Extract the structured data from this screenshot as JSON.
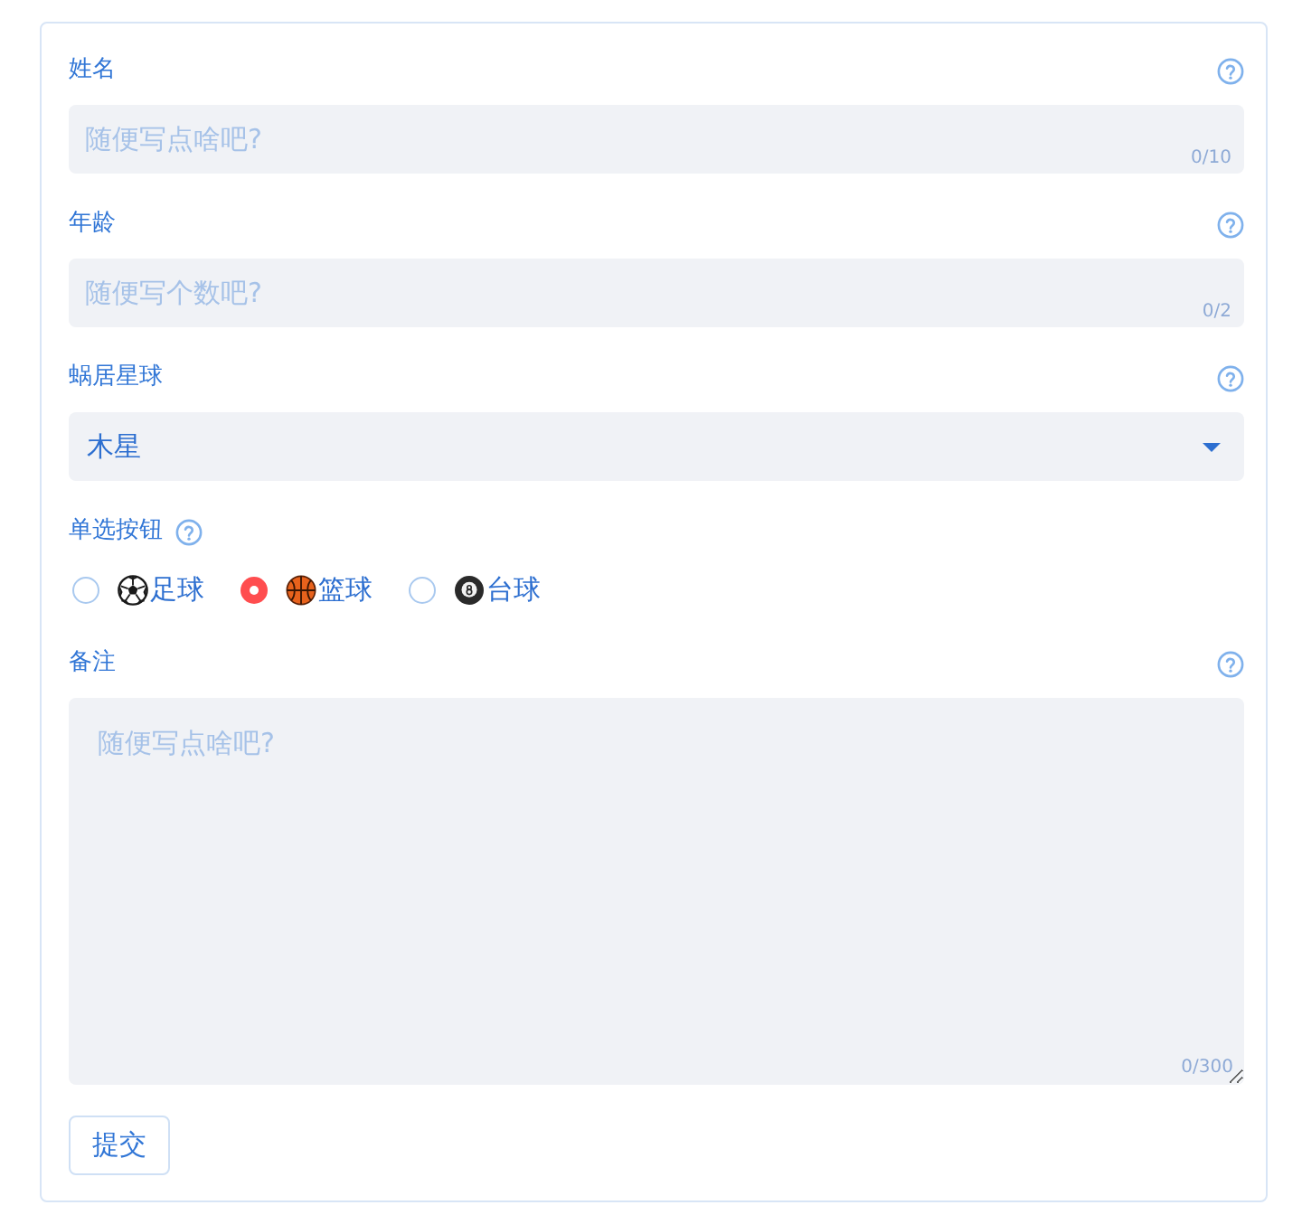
{
  "form": {
    "fields": [
      {
        "kind": "input",
        "label": "姓名",
        "help": true,
        "placeholder": "随便写点啥吧?",
        "counter": "0/10"
      },
      {
        "kind": "input",
        "label": "年龄",
        "help": true,
        "placeholder": "随便写个数吧?",
        "counter": "0/2"
      },
      {
        "kind": "select",
        "label": "蜗居星球",
        "help": true,
        "value": "木星"
      },
      {
        "kind": "radio",
        "label": "单选按钮",
        "help": true,
        "options": [
          {
            "label": "足球",
            "selected": false
          },
          {
            "label": "篮球",
            "selected": true
          },
          {
            "label": "台球",
            "selected": false
          }
        ]
      },
      {
        "kind": "textarea",
        "label": "备注",
        "help": true,
        "placeholder": "随便写点啥吧?",
        "counter": "0/300"
      }
    ],
    "submit": "提交"
  }
}
